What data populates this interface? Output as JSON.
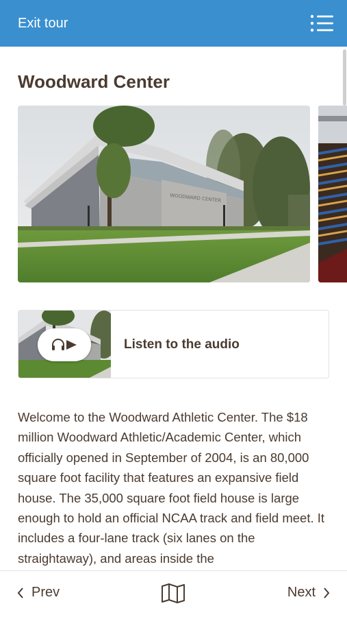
{
  "header": {
    "exit_label": "Exit tour",
    "background": "#3a8fcf",
    "menu_icon": "hamburger-list-icon"
  },
  "page": {
    "title": "Woodward Center"
  },
  "audio": {
    "label": "Listen to the audio",
    "icon": "headphones-play-icon"
  },
  "body": {
    "text": "Welcome to the Woodward Athletic Center. The $18 million Woodward Athletic/Academic Center, which officially opened in September of 2004, is an 80,000 square foot facility that features an expansive field house. The 35,000 square foot field house is large enough to hold an official NCAA track and field meet. It includes a four-lane track (six lanes on the straightaway), and areas inside the"
  },
  "nav": {
    "prev_label": "Prev",
    "next_label": "Next",
    "map_icon": "map-icon"
  },
  "colors": {
    "text": "#4a3b30",
    "accent": "#3a8fcf"
  }
}
